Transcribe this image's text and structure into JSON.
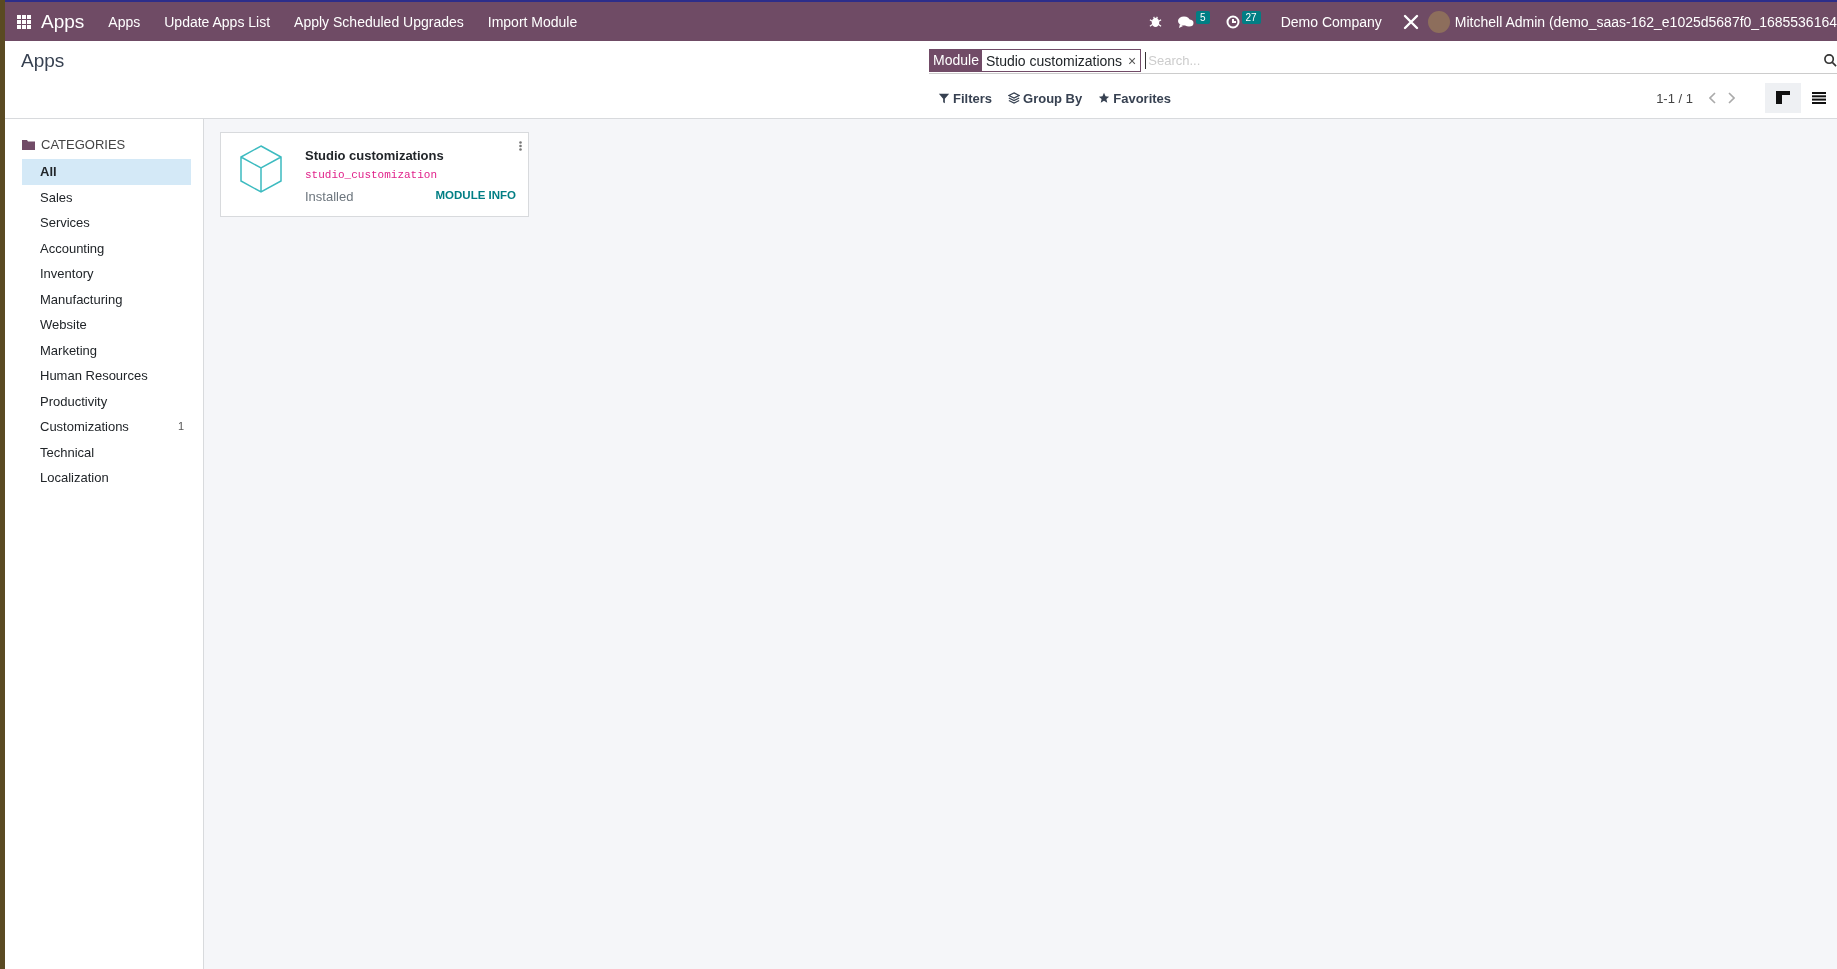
{
  "navbar": {
    "app_name": "Apps",
    "menu": [
      "Apps",
      "Update Apps List",
      "Apply Scheduled Upgrades",
      "Import Module"
    ],
    "messages_count": "5",
    "activities_count": "27",
    "company": "Demo Company",
    "user": "Mitchell Admin (demo_saas-162_e1025d5687f0_1685536164"
  },
  "control_panel": {
    "title": "Apps",
    "facet": {
      "field": "Module",
      "value": "Studio customizations",
      "remove": "×"
    },
    "search": {
      "placeholder": "Search..."
    },
    "filters": [
      "Filters",
      "Group By",
      "Favorites"
    ],
    "pager": "1-1 / 1",
    "views": [
      {
        "kind": "kanban",
        "selected": true
      },
      {
        "kind": "list",
        "selected": false
      }
    ]
  },
  "sidebar": {
    "heading": "CATEGORIES",
    "items": [
      {
        "label": "All",
        "selected": true
      },
      {
        "label": "Sales",
        "selected": false
      },
      {
        "label": "Services",
        "selected": false
      },
      {
        "label": "Accounting",
        "selected": false
      },
      {
        "label": "Inventory",
        "selected": false
      },
      {
        "label": "Manufacturing",
        "selected": false
      },
      {
        "label": "Website",
        "selected": false
      },
      {
        "label": "Marketing",
        "selected": false
      },
      {
        "label": "Human Resources",
        "selected": false
      },
      {
        "label": "Productivity",
        "selected": false
      },
      {
        "label": "Customizations",
        "selected": false,
        "count": "1"
      },
      {
        "label": "Technical",
        "selected": false
      },
      {
        "label": "Localization",
        "selected": false
      }
    ]
  },
  "modules": [
    {
      "name": "Studio customizations",
      "technical_name": "studio_customization",
      "status": "Installed",
      "action": "MODULE INFO"
    }
  ]
}
